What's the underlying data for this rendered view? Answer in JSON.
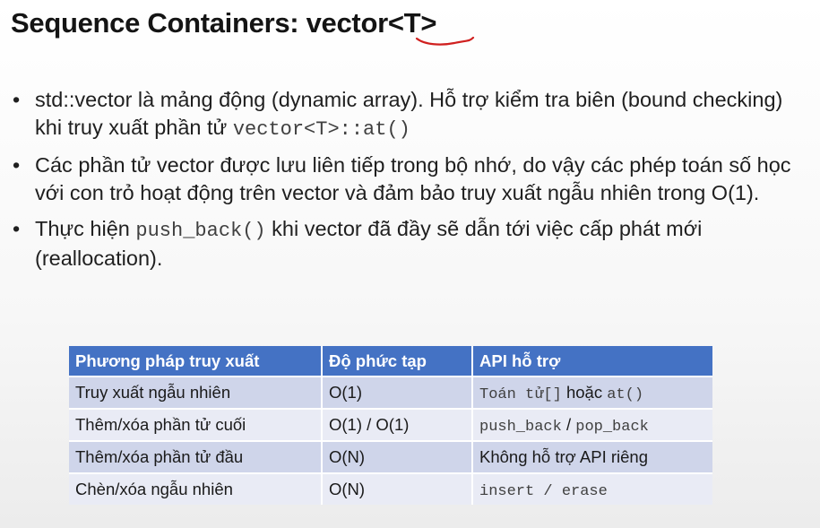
{
  "title": {
    "prefix": "Sequence Containers: vector",
    "template_param": "<T>"
  },
  "bullets": [
    {
      "text": "std::vector là mảng động (dynamic array). Hỗ trợ kiểm tra biên (bound checking) khi truy xuất phần tử ",
      "code": "vector<T>::at()"
    },
    {
      "text": "Các phần tử vector được lưu liên tiếp trong bộ nhớ, do vậy các phép toán số học với con trỏ hoạt động trên vector và đảm bảo truy xuất ngẫu nhiên trong O(1)."
    },
    {
      "text_before": "Thực hiện ",
      "code": "push_back()",
      "text_after": " khi vector đã đầy sẽ dẫn tới việc cấp phát mới (reallocation)."
    }
  ],
  "table": {
    "headers": [
      "Phương pháp truy xuất",
      "Độ phức tạp",
      "API  hỗ trợ"
    ],
    "rows": [
      {
        "method": "Truy xuất ngẫu nhiên",
        "complexity": "O(1)",
        "api_code": "Toán tử[]",
        "api_text": " hoặc ",
        "api_code2": "at()"
      },
      {
        "method": "Thêm/xóa phần tử cuối",
        "complexity": "O(1) / O(1)",
        "api_code": "push_back",
        "api_text": " / ",
        "api_code2": "pop_back"
      },
      {
        "method": "Thêm/xóa phần tử đầu",
        "complexity": "O(N)",
        "api_text": "Không hỗ trợ API riêng"
      },
      {
        "method": "Chèn/xóa ngẫu nhiên",
        "complexity": "O(N)",
        "api_code": "insert / erase"
      }
    ]
  },
  "colors": {
    "header_bg": "#4472c4",
    "row_odd": "#cfd5ea",
    "row_even": "#e9ebf5",
    "underline_annotation": "#d0201f"
  }
}
